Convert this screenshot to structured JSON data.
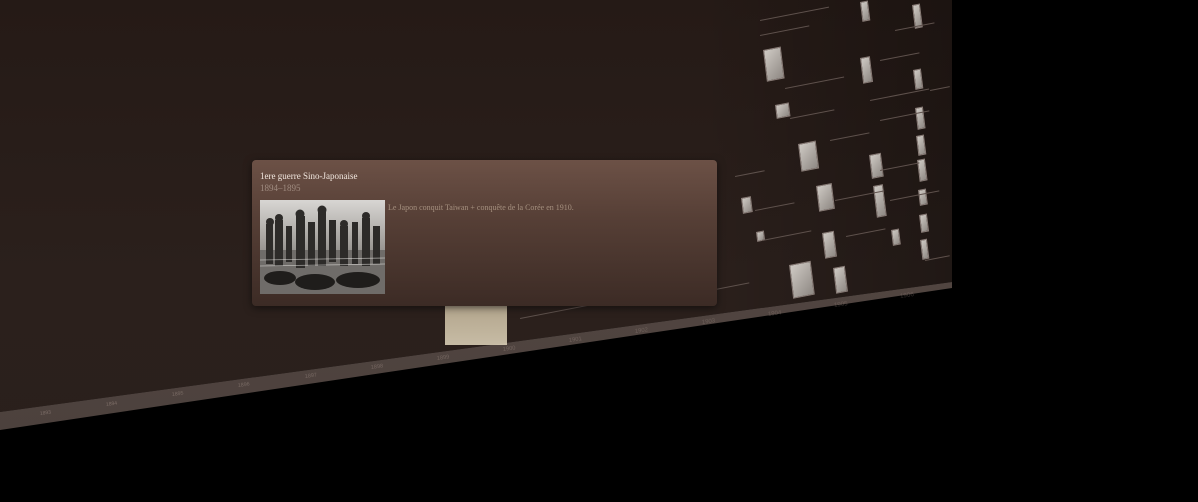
{
  "timeline": {
    "axis_labels": [
      "1893",
      "1894",
      "1895",
      "1896",
      "1897",
      "1898",
      "1899",
      "1900",
      "1901",
      "1902",
      "1903",
      "1904",
      "1905",
      "1906"
    ]
  },
  "event_card": {
    "title": "1ere guerre Sino-Japonaise",
    "dates": "1894–1895",
    "description": "Le Japon conquit Taiwan + conquête de la Corée en 1910.",
    "photo_alt": "Gravure de soldats de la guerre sino-japonaise"
  },
  "colors": {
    "background": "#000000",
    "plane": "#2a1f1b",
    "card_top": "#6c5146",
    "card_bottom": "#3c2b25",
    "title_text": "#f1e7df",
    "muted_text": "#a08c81"
  }
}
